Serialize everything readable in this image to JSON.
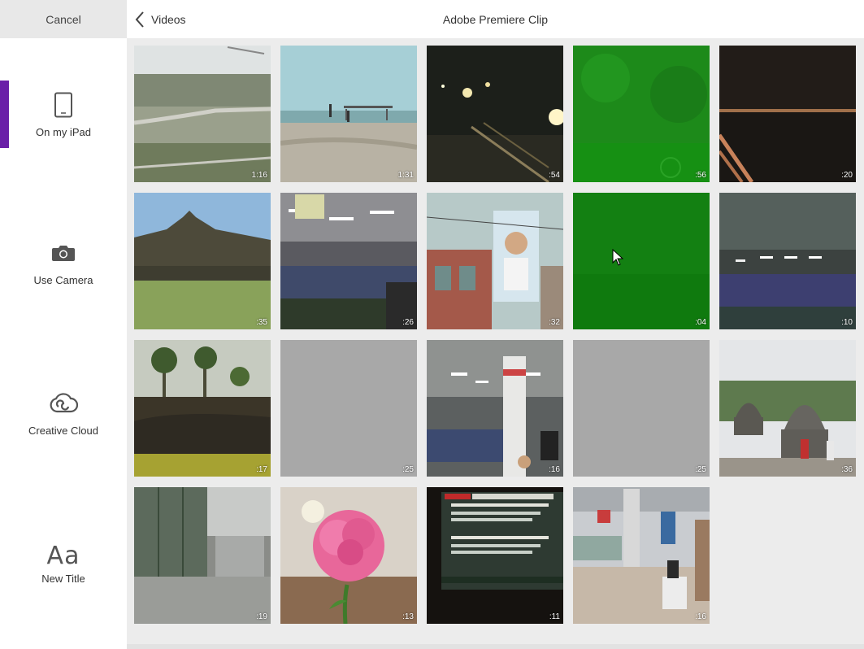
{
  "sidebar": {
    "cancel_label": "Cancel",
    "items": [
      {
        "label": "On my iPad",
        "icon": "ipad-icon",
        "active": true
      },
      {
        "label": "Use Camera",
        "icon": "camera-icon",
        "active": false
      },
      {
        "label": "Creative Cloud",
        "icon": "creative-cloud-icon",
        "active": false
      },
      {
        "label": "New Title",
        "icon": "new-title-icon",
        "glyph": "Aa",
        "active": false
      }
    ]
  },
  "header": {
    "back_label": "Videos",
    "title": "Adobe Premiere Clip"
  },
  "colors": {
    "accent": "#6a1fa8",
    "sidebar_bg": "#ffffff",
    "content_bg": "#ececec",
    "placeholder_tile": "#a8a8a8"
  },
  "videos": [
    {
      "duration": "1:16",
      "scene": "aerial"
    },
    {
      "duration": "1:31",
      "scene": "beach"
    },
    {
      "duration": ":54",
      "scene": "night-street"
    },
    {
      "duration": ":56",
      "scene": "night-vision"
    },
    {
      "duration": ":20",
      "scene": "night-airfield"
    },
    {
      "duration": ":35",
      "scene": "temple-lawn"
    },
    {
      "duration": ":26",
      "scene": "factory"
    },
    {
      "duration": ":32",
      "scene": "billboard"
    },
    {
      "duration": ":04",
      "scene": "green-blank"
    },
    {
      "duration": ":10",
      "scene": "factory-wide"
    },
    {
      "duration": ":17",
      "scene": "palm-garden"
    },
    {
      "duration": ":25",
      "scene": "loading"
    },
    {
      "duration": ":16",
      "scene": "factory-pillar"
    },
    {
      "duration": ":25",
      "scene": "loading"
    },
    {
      "duration": ":36",
      "scene": "stupas"
    },
    {
      "duration": ":19",
      "scene": "window-reflection"
    },
    {
      "duration": ":13",
      "scene": "pink-rose"
    },
    {
      "duration": ":11",
      "scene": "tv-screen"
    },
    {
      "duration": ":16",
      "scene": "airport-hall"
    }
  ]
}
